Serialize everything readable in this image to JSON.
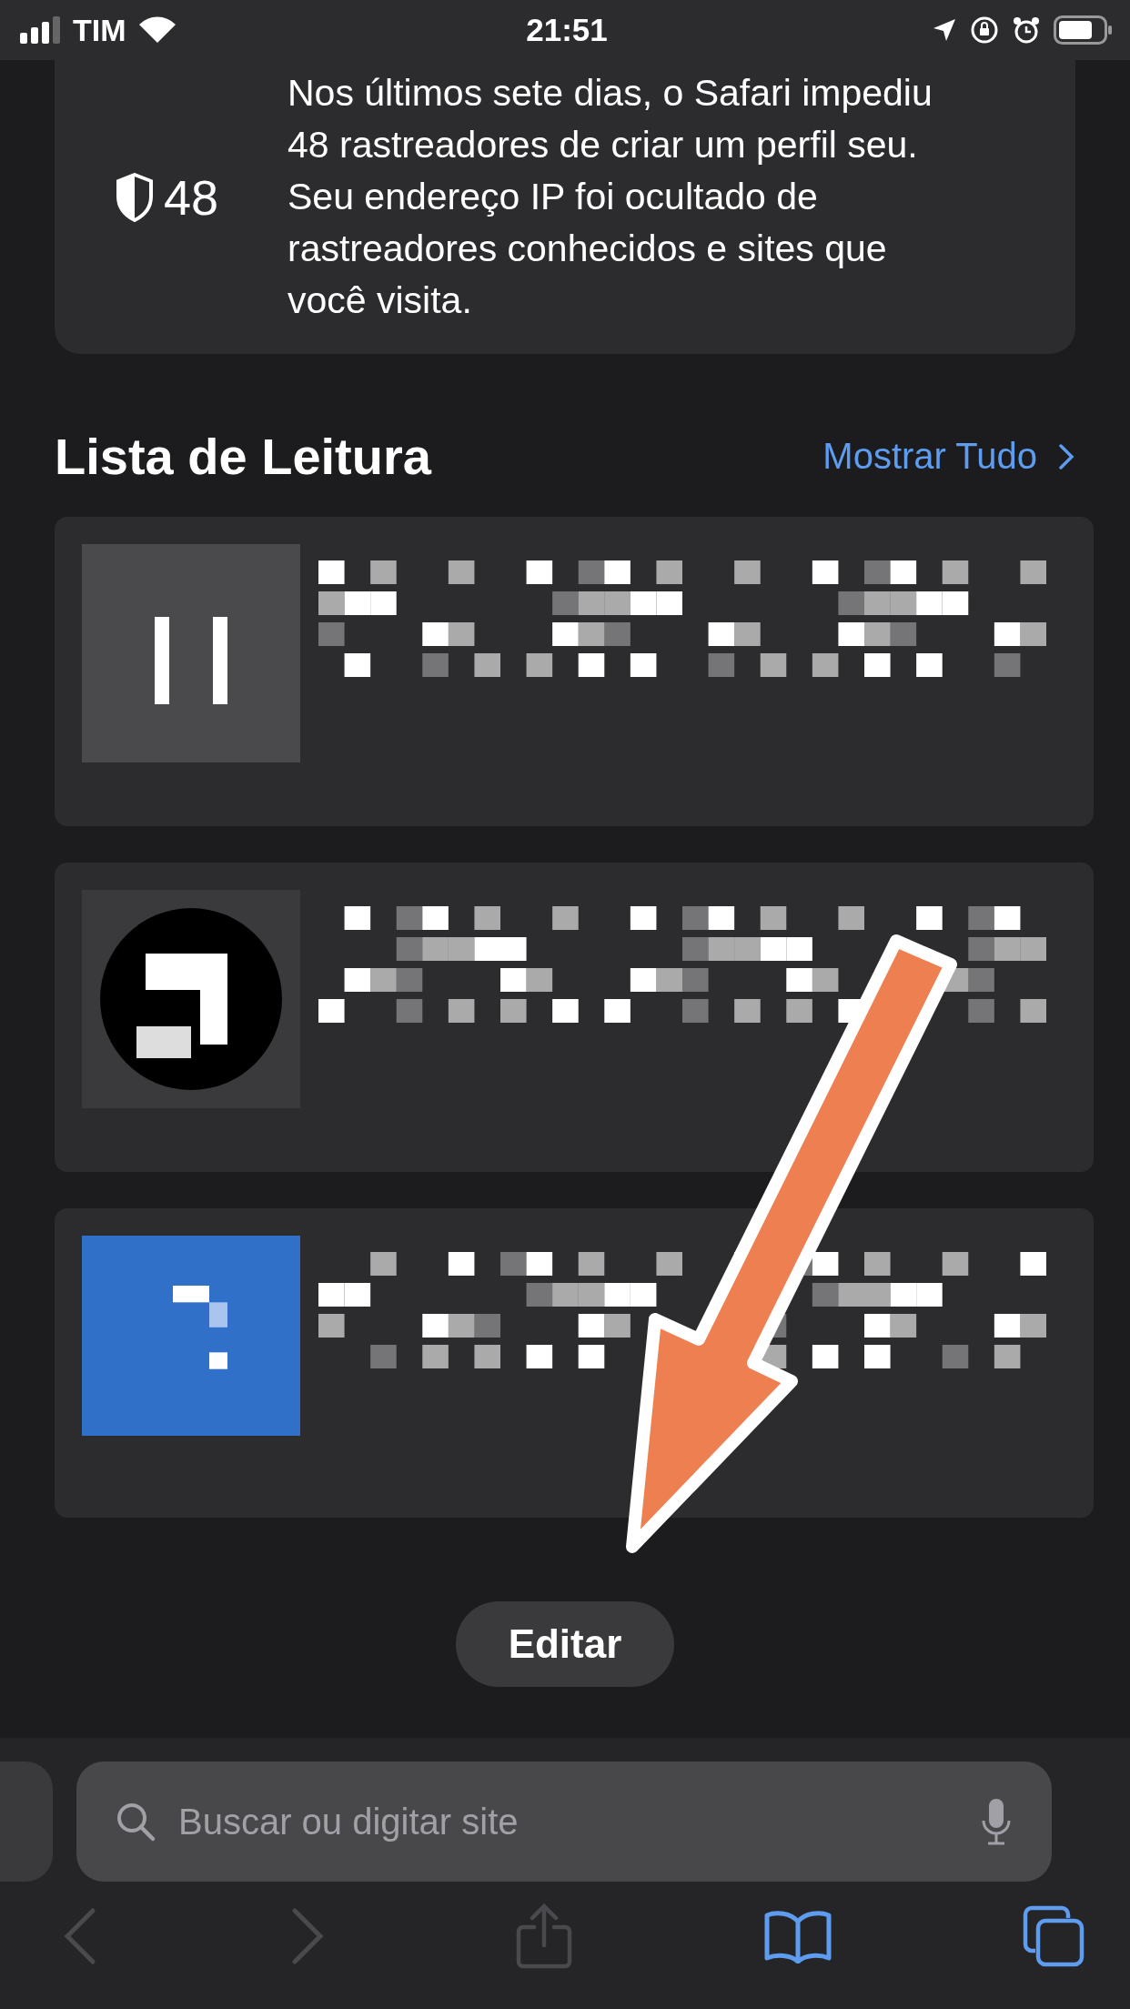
{
  "status_bar": {
    "carrier": "TIM",
    "time": "21:51"
  },
  "privacy_report": {
    "count": "48",
    "text": "Nos últimos sete dias, o Safari impediu 48 rastreadores de criar um perfil seu. Seu endereço IP foi ocultado de rastreadores conhecidos e sites que você visita."
  },
  "reading_list": {
    "title": "Lista de Leitura",
    "show_all": "Mostrar Tudo"
  },
  "edit_button": "Editar",
  "address_bar": {
    "placeholder": "Buscar ou digitar site"
  },
  "toolbar": [
    {
      "kind": "back",
      "disabled": true
    },
    {
      "kind": "forward",
      "disabled": true
    },
    {
      "kind": "share",
      "disabled": true
    },
    {
      "kind": "bookmarks",
      "disabled": false
    },
    {
      "kind": "tabs",
      "disabled": false
    }
  ]
}
